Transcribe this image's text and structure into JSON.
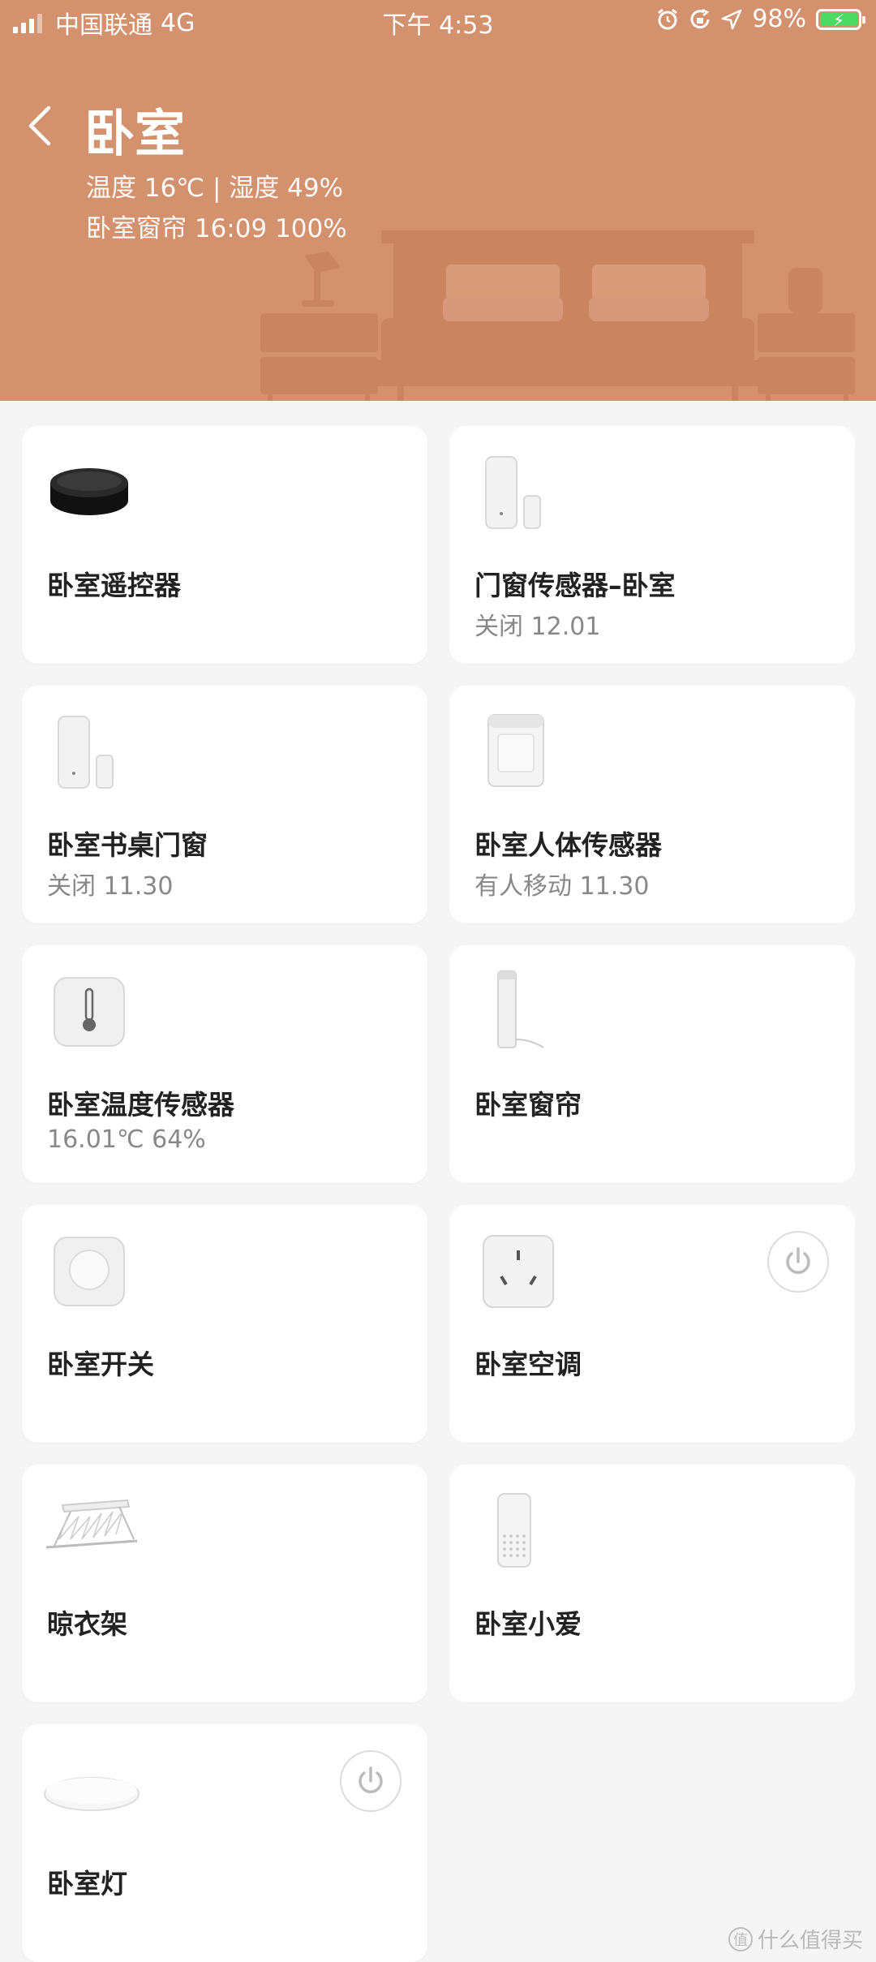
{
  "status_bar": {
    "carrier": "中国联通",
    "network": "4G",
    "time": "下午 4:53",
    "battery": "98%"
  },
  "header": {
    "title": "卧室",
    "info_line1": "温度 16℃ | 湿度 49%",
    "info_line2": "卧室窗帘 16:09 100%",
    "background_color": "#d3916d"
  },
  "devices": [
    {
      "name": "卧室遥控器",
      "status": "",
      "icon": "ir-remote-icon",
      "has_power": false
    },
    {
      "name": "门窗传感器–卧室",
      "status": "关闭 12.01",
      "icon": "door-window-sensor-icon",
      "has_power": false
    },
    {
      "name": "卧室书桌门窗",
      "status": "关闭 11.30",
      "icon": "door-window-sensor-icon",
      "has_power": false
    },
    {
      "name": "卧室人体传感器",
      "status": "有人移动 11.30",
      "icon": "motion-sensor-icon",
      "has_power": false
    },
    {
      "name": "卧室温度传感器",
      "status": "16.01℃ 64%",
      "icon": "temperature-sensor-icon",
      "has_power": false
    },
    {
      "name": "卧室窗帘",
      "status": "",
      "icon": "curtain-motor-icon",
      "has_power": false
    },
    {
      "name": "卧室开关",
      "status": "",
      "icon": "wireless-switch-icon",
      "has_power": false
    },
    {
      "name": "卧室空调",
      "status": "",
      "icon": "ac-plug-icon",
      "has_power": true
    },
    {
      "name": "晾衣架",
      "status": "",
      "icon": "clothes-rack-icon",
      "has_power": false
    },
    {
      "name": "卧室小爱",
      "status": "",
      "icon": "smart-speaker-icon",
      "has_power": false
    },
    {
      "name": "卧室灯",
      "status": "",
      "icon": "ceiling-light-icon",
      "has_power": true
    }
  ],
  "watermark": {
    "badge": "值",
    "text": "什么值得买"
  }
}
